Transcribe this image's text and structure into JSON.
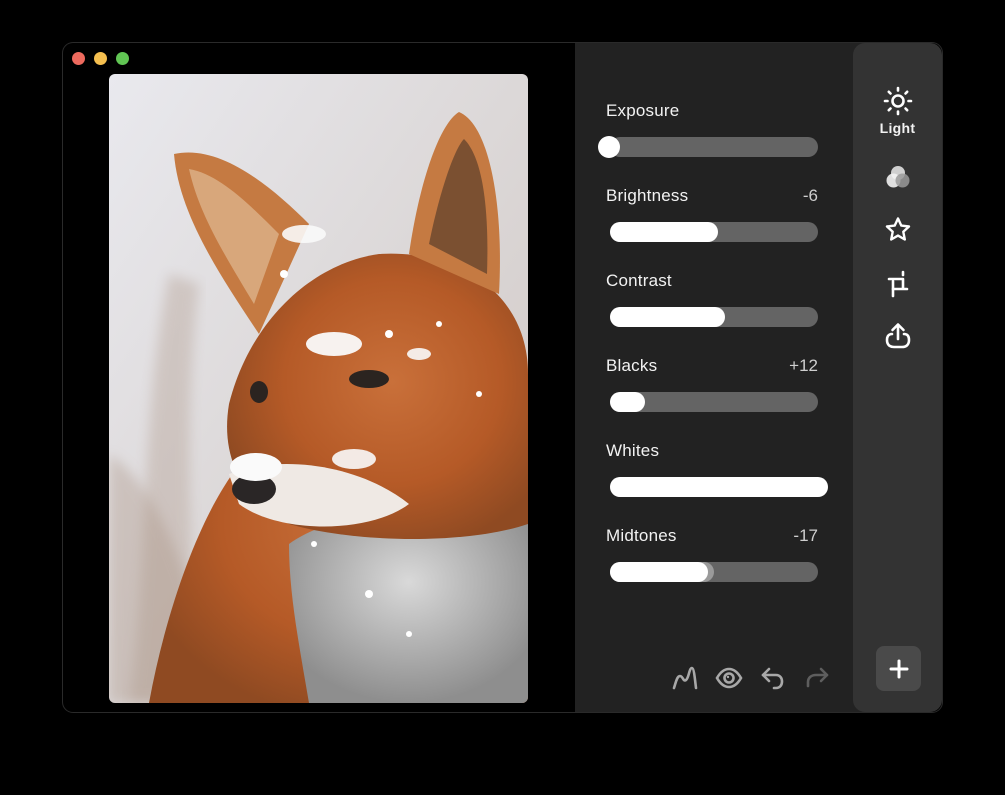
{
  "window": {
    "controls": [
      "close",
      "minimize",
      "zoom"
    ]
  },
  "photo": {
    "subject": "red fox with snow on face",
    "alt": "Red fox portrait in snow"
  },
  "adjustments": [
    {
      "id": "exposure",
      "label": "Exposure",
      "value": "",
      "fill": 0.0,
      "style": "knob"
    },
    {
      "id": "brightness",
      "label": "Brightness",
      "value": "-6",
      "fill": 0.52,
      "style": "fill"
    },
    {
      "id": "contrast",
      "label": "Contrast",
      "value": "",
      "fill": 0.555,
      "style": "fill"
    },
    {
      "id": "blacks",
      "label": "Blacks",
      "value": "+12",
      "fill": 0.17,
      "style": "fill"
    },
    {
      "id": "whites",
      "label": "Whites",
      "value": "",
      "fill": 1.05,
      "style": "fill"
    },
    {
      "id": "midtones",
      "label": "Midtones",
      "value": "-17",
      "fill": 0.47,
      "ghost": 0.5,
      "style": "fill"
    }
  ],
  "bottom_tools": [
    {
      "id": "curves",
      "icon": "curve-icon"
    },
    {
      "id": "preview",
      "icon": "eye-icon"
    },
    {
      "id": "undo",
      "icon": "undo-icon",
      "enabled": true
    },
    {
      "id": "redo",
      "icon": "redo-icon",
      "enabled": false
    }
  ],
  "sidebar": {
    "items": [
      {
        "id": "light",
        "icon": "sun-icon",
        "label": "Light",
        "active": true
      },
      {
        "id": "color",
        "icon": "color-circles-icon",
        "label": ""
      },
      {
        "id": "effects",
        "icon": "star-icon",
        "label": ""
      },
      {
        "id": "crop",
        "icon": "crop-icon",
        "label": ""
      },
      {
        "id": "share",
        "icon": "share-icon",
        "label": ""
      }
    ],
    "add_label": "+"
  },
  "colors": {
    "panel_bg": "#222222",
    "sidebar_bg": "#333333",
    "track": "#646464",
    "fill": "#ffffff",
    "close": "#ed6a5e",
    "minimize": "#f5bf4f",
    "zoom": "#61c554"
  }
}
